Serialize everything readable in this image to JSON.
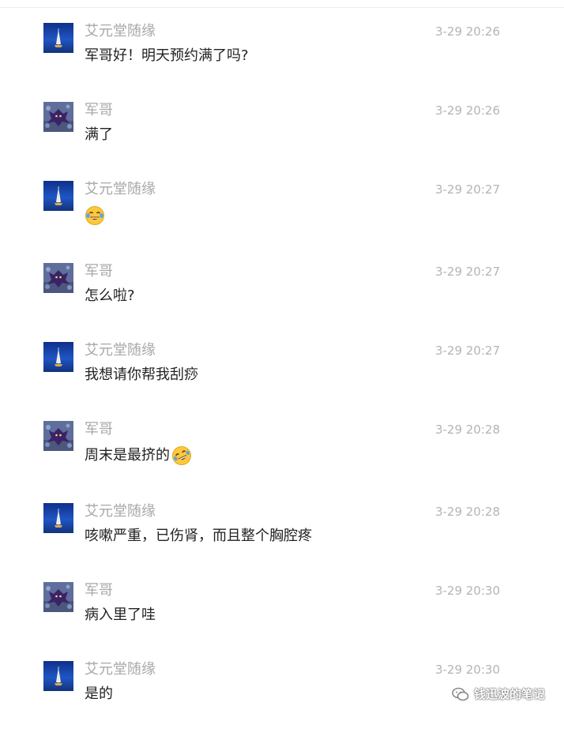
{
  "messages": [
    {
      "sender": "艾元堂随缘",
      "avatar": "sailboat-avatar",
      "time": "3-29 20:26",
      "text": "军哥好！明天预约满了吗?",
      "emoji": ""
    },
    {
      "sender": "军哥",
      "avatar": "dragon-avatar",
      "time": "3-29 20:26",
      "text": "满了",
      "emoji": ""
    },
    {
      "sender": "艾元堂随缘",
      "avatar": "sailboat-avatar",
      "time": "3-29 20:27",
      "text": "",
      "emoji": "tears-of-joy-emoji"
    },
    {
      "sender": "军哥",
      "avatar": "dragon-avatar",
      "time": "3-29 20:27",
      "text": "怎么啦?",
      "emoji": ""
    },
    {
      "sender": "艾元堂随缘",
      "avatar": "sailboat-avatar",
      "time": "3-29 20:27",
      "text": "我想请你帮我刮痧",
      "emoji": ""
    },
    {
      "sender": "军哥",
      "avatar": "dragon-avatar",
      "time": "3-29 20:28",
      "text": "周末是最挤的",
      "emoji": "rolling-laughing-emoji"
    },
    {
      "sender": "艾元堂随缘",
      "avatar": "sailboat-avatar",
      "time": "3-29 20:28",
      "text": "咳嗽严重，已伤肾，而且整个胸腔疼",
      "emoji": ""
    },
    {
      "sender": "军哥",
      "avatar": "dragon-avatar",
      "time": "3-29 20:30",
      "text": "病入里了哇",
      "emoji": ""
    },
    {
      "sender": "艾元堂随缘",
      "avatar": "sailboat-avatar",
      "time": "3-29 20:30",
      "text": "是的",
      "emoji": ""
    }
  ],
  "watermark": {
    "text": "钱迅波的笔记",
    "icon": "wechat-icon"
  },
  "colors": {
    "name": "#a8a8a8",
    "time": "#b4b4b4",
    "text": "#222222"
  }
}
